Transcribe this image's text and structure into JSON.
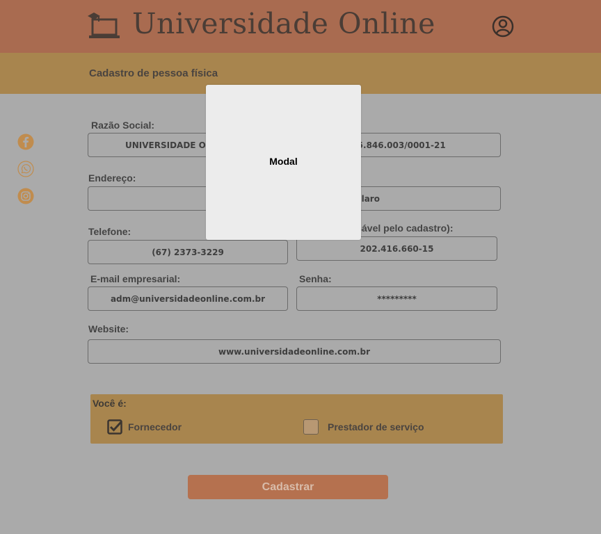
{
  "header": {
    "brand": "Universidade Online",
    "logo_icon": "laptop-graduation-cap-icon",
    "user_icon": "user-circle-icon"
  },
  "subheader": {
    "title": "Cadastro de pessoa física"
  },
  "social": [
    {
      "name": "facebook-icon"
    },
    {
      "name": "whatsapp-icon"
    },
    {
      "name": "instagram-icon"
    }
  ],
  "form": {
    "razao_social": {
      "label": "Razão Social:",
      "value": "UNIVERSIDADE ONLINE"
    },
    "cnpj": {
      "value": "45.846.003/0001-21"
    },
    "endereco": {
      "label": "Endereço:",
      "value": ""
    },
    "cidade": {
      "value": "Rio Claro"
    },
    "telefone": {
      "label": "Telefone:",
      "value": "(67) 2373-3229"
    },
    "cpf_responsavel": {
      "label": "CPF (responsável pelo cadastro):",
      "value": "202.416.660-15"
    },
    "email": {
      "label": "E-mail empresarial:",
      "value": "adm@universidadeonline.com.br"
    },
    "senha": {
      "label": "Senha:",
      "value": "*********"
    },
    "website": {
      "label": "Website:",
      "value": "www.universidadeonline.com.br"
    }
  },
  "choice": {
    "title": "Você é:",
    "options": [
      {
        "label": "Fornecedor",
        "checked": true
      },
      {
        "label": "Prestador de serviço",
        "checked": false
      }
    ]
  },
  "submit_label": "Cadastrar",
  "modal": {
    "text": "Modal"
  },
  "colors": {
    "header": "#a96b50",
    "subbar": "#a8854e",
    "background": "#aaaaaa",
    "button": "#b5714f",
    "modal": "#ececec"
  }
}
